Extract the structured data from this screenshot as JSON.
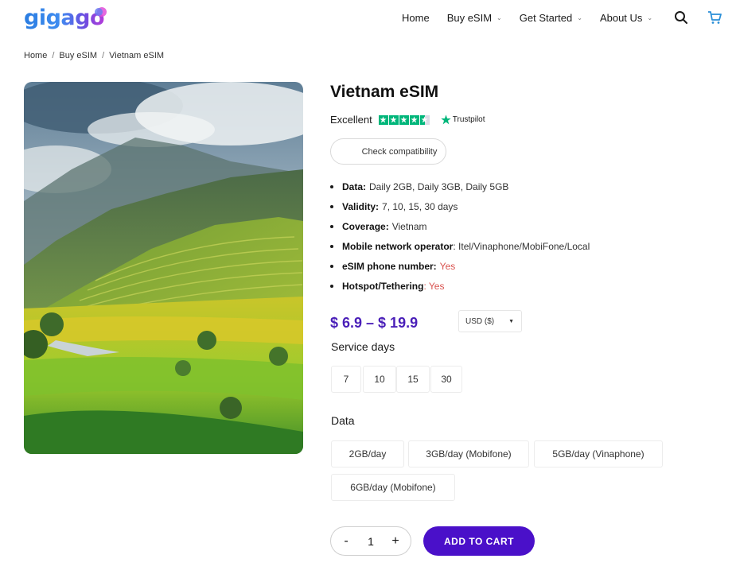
{
  "brand": {
    "logo_text": "gigago"
  },
  "nav": {
    "items": [
      {
        "label": "Home",
        "dropdown": false
      },
      {
        "label": "Buy eSIM",
        "dropdown": true
      },
      {
        "label": "Get Started",
        "dropdown": true
      },
      {
        "label": "About Us",
        "dropdown": true
      }
    ],
    "icons": [
      "search-icon",
      "cart-icon"
    ]
  },
  "breadcrumb": [
    "Home",
    "Buy eSIM",
    "Vietnam eSIM"
  ],
  "product": {
    "title": "Vietnam eSIM",
    "rating_text": "Excellent",
    "rating_stars": 4.5,
    "trustpilot_label": "Trustpilot",
    "compat_button": "Check compatibility",
    "specs": [
      {
        "key": "Data:",
        "value": "Daily 2GB, Daily 3GB, Daily 5GB"
      },
      {
        "key": "Validity:",
        "value": "7, 10, 15, 30 days"
      },
      {
        "key": "Coverage:",
        "value": "Vietnam"
      },
      {
        "key": "Mobile network operator",
        "value": ": Itel/Vinaphone/MobiFone/Local"
      },
      {
        "key": "eSIM phone number:",
        "value": "Yes",
        "highlight": true
      },
      {
        "key": "Hotspot/Tethering",
        "value": ": Yes",
        "highlight": true
      }
    ],
    "price": "$ 6.9 – $ 19.9",
    "currency": "USD ($)",
    "service_days_label": "Service days",
    "service_days": [
      "7",
      "10",
      "15",
      "30"
    ],
    "data_label": "Data",
    "data_options": [
      "2GB/day",
      "3GB/day (Mobifone)",
      "5GB/day (Vinaphone)",
      "6GB/day (Mobifone)"
    ],
    "quantity": "1",
    "qty_minus": "-",
    "qty_plus": "+",
    "add_to_cart": "ADD TO CART"
  },
  "colors": {
    "accent": "#4a10c9",
    "price": "#4a1fb8",
    "trustpilot": "#00b67a",
    "yes": "#d9534f"
  }
}
